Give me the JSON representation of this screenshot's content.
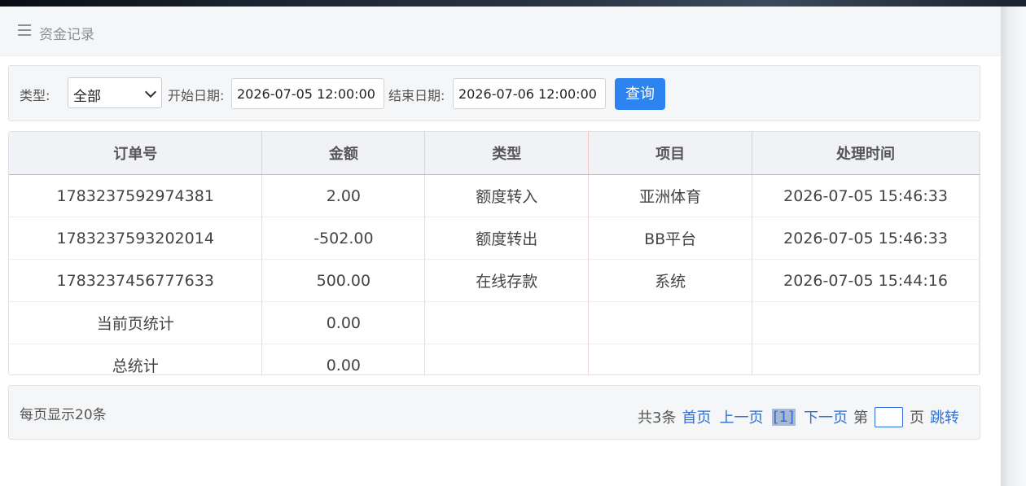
{
  "header": {
    "title": "资金记录"
  },
  "filters": {
    "type_label": "类型:",
    "type_value": "全部",
    "start_label": "开始日期:",
    "start_value": "2026-07-05 12:00:00",
    "end_label": "结束日期:",
    "end_value": "2026-07-06 12:00:00",
    "query_label": "查询"
  },
  "table": {
    "columns": [
      "订单号",
      "金额",
      "类型",
      "项目",
      "处理时间"
    ],
    "rows": [
      [
        "1783237592974381",
        "2.00",
        "额度转入",
        "亚洲体育",
        "2026-07-05 15:46:33"
      ],
      [
        "1783237593202014",
        "-502.00",
        "额度转出",
        "BB平台",
        "2026-07-05 15:46:33"
      ],
      [
        "1783237456777633",
        "500.00",
        "在线存款",
        "系统",
        "2026-07-05 15:44:16"
      ]
    ],
    "summary": [
      [
        "当前页统计",
        "0.00",
        "",
        "",
        ""
      ],
      [
        "总统计",
        "0.00",
        "",
        "",
        ""
      ]
    ]
  },
  "pager": {
    "per_page": "每页显示20条",
    "total": "共3条",
    "first": "首页",
    "prev": "上一页",
    "current": "[1]",
    "next": "下一页",
    "goto_prefix": "第",
    "goto_suffix": "页",
    "jump": "跳转"
  },
  "colors": {
    "accent": "#2d84f0",
    "link": "#2d6fd6"
  }
}
